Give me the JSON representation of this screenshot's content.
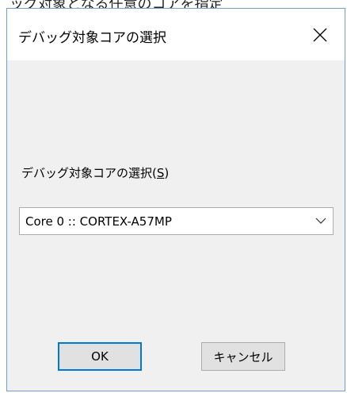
{
  "background": {
    "partial_text": "ッグ対象となる任意のコアを指定"
  },
  "dialog": {
    "title": "デバッグ対象コアの選択",
    "close_icon": "close-icon",
    "field_label": "デバッグ対象コアの選択",
    "field_label_accel_open": "(",
    "field_label_accel_key": "S",
    "field_label_accel_close": ")",
    "select_value": "Core 0 :: CORTEX-A57MP",
    "chevron_icon": "chevron-down-icon",
    "ok_label": "OK",
    "cancel_label": "キャンセル"
  },
  "colors": {
    "dialog_border": "#6f9fd8",
    "default_button_border": "#0078d7",
    "dialog_body": "#f0f0f0"
  }
}
